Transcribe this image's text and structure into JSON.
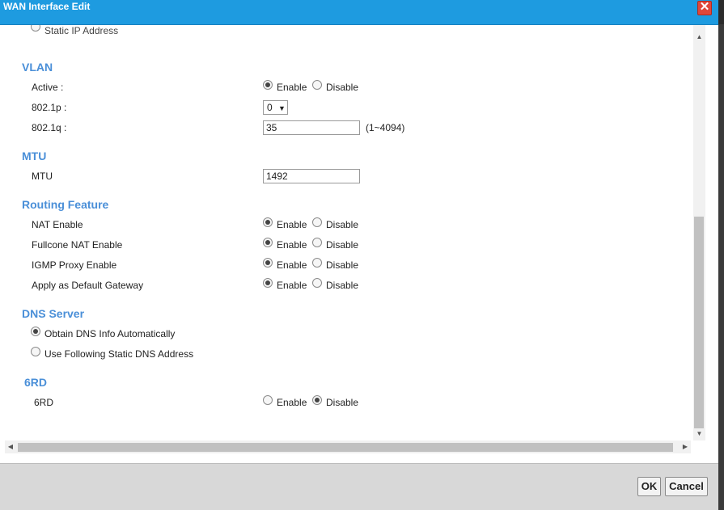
{
  "title": "WAN Interface Edit",
  "close_symbol": "✕",
  "partial_top": "Static IP Address",
  "sections": {
    "vlan": "VLAN",
    "mtu": "MTU",
    "routing": "Routing Feature",
    "dns": "DNS Server",
    "sixrd": "6RD"
  },
  "labels": {
    "active": "Active :",
    "p8021": "802.1p :",
    "q8021": "802.1q :",
    "mtu": "MTU",
    "nat": "NAT Enable",
    "fullcone": "Fullcone NAT Enable",
    "igmp": "IGMP Proxy Enable",
    "default_gw": "Apply as Default Gateway",
    "sixrd": "6RD"
  },
  "options": {
    "enable": "Enable",
    "disable": "Disable"
  },
  "selected": {
    "active": "Enable",
    "nat": "Enable",
    "fullcone": "Enable",
    "igmp": "Enable",
    "default_gw": "Enable",
    "sixrd": "Disable",
    "dns": "Obtain DNS Info Automatically"
  },
  "fields": {
    "p8021_value": "0",
    "p8021_arrow": "▼",
    "q8021_value": "35",
    "q8021_hint": "(1~4094)",
    "mtu_value": "1492"
  },
  "dns": {
    "auto": "Obtain DNS Info Automatically",
    "static": "Use Following Static DNS Address"
  },
  "buttons": {
    "ok": "OK",
    "cancel": "Cancel"
  },
  "scroll_icons": {
    "up": "▲",
    "down": "▼",
    "left": "◀",
    "right": "▶"
  }
}
